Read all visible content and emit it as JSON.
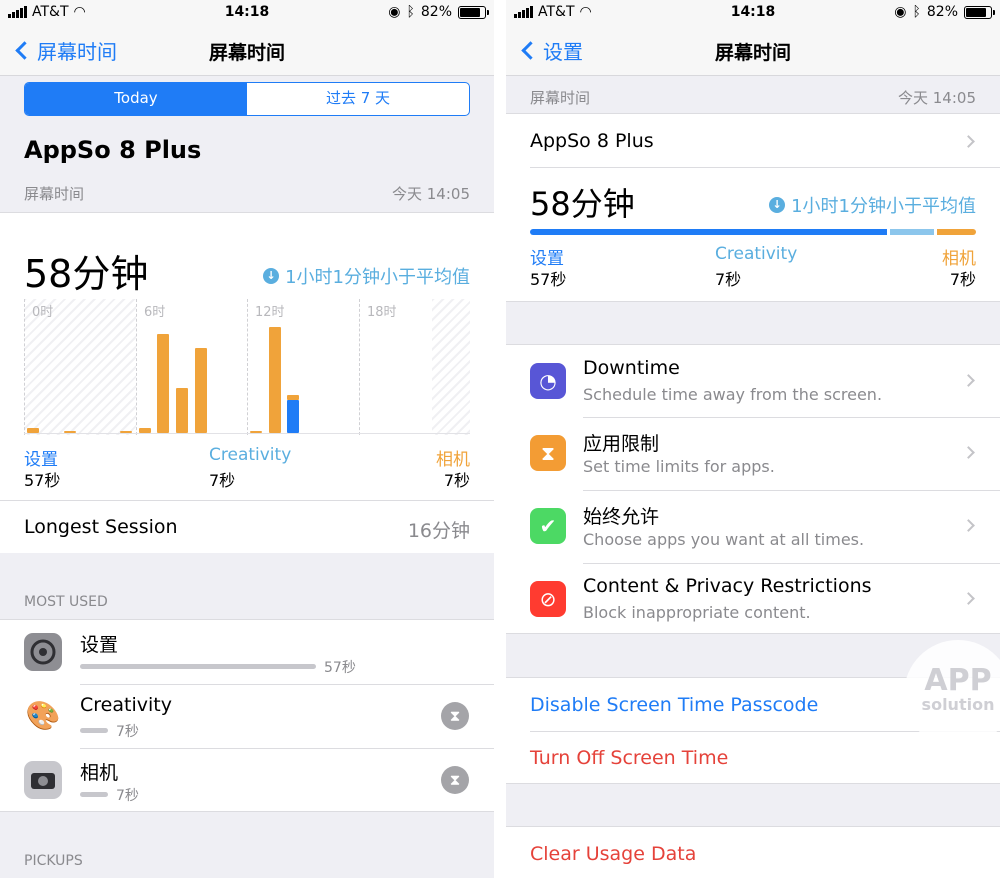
{
  "left": {
    "status": {
      "carrier": "AT&T",
      "time": "14:18",
      "battery": "82%"
    },
    "nav": {
      "back": "屏幕时间",
      "title": "屏幕时间"
    },
    "segment": {
      "today": "Today",
      "week": "过去 7 天"
    },
    "device": "AppSo 8 Plus",
    "section_label": "屏幕时间",
    "timestamp": "今天 14:05",
    "total": "58分钟",
    "avg_note": "1小时1分钟小于平均值",
    "categories": [
      {
        "name": "设置",
        "time": "57秒",
        "color": "#1f7cf6"
      },
      {
        "name": "Creativity",
        "time": "7秒",
        "color": "#5aaedf"
      },
      {
        "name": "相机",
        "time": "7秒",
        "color": "#f0a33a"
      }
    ],
    "longest_label": "Longest Session",
    "longest_value": "16分钟",
    "most_used_header": "MOST USED",
    "apps": [
      {
        "name": "设置",
        "time": "57秒",
        "icon": "settings-gear-icon"
      },
      {
        "name": "Creativity",
        "time": "7秒",
        "icon": "palette-icon"
      },
      {
        "name": "相机",
        "time": "7秒",
        "icon": "camera-icon"
      }
    ],
    "pickups_header": "PICKUPS"
  },
  "right": {
    "status": {
      "carrier": "AT&T",
      "time": "14:18",
      "battery": "82%"
    },
    "nav": {
      "back": "设置",
      "title": "屏幕时间"
    },
    "section_label": "屏幕时间",
    "timestamp": "今天 14:05",
    "device": "AppSo 8 Plus",
    "total": "58分钟",
    "avg_note": "1小时1分钟小于平均值",
    "categories": [
      {
        "name": "设置",
        "time": "57秒"
      },
      {
        "name": "Creativity",
        "time": "7秒"
      },
      {
        "name": "相机",
        "time": "7秒"
      }
    ],
    "menu": [
      {
        "title": "Downtime",
        "subtitle": "Schedule time away from the screen.",
        "icon": "downtime-moon-icon",
        "color": "#5856d6"
      },
      {
        "title": "应用限制",
        "subtitle": "Set time limits for apps.",
        "icon": "hourglass-icon",
        "color": "#f39c34"
      },
      {
        "title": "始终允许",
        "subtitle": "Choose apps you want at all times.",
        "icon": "checkmark-badge-icon",
        "color": "#4cd964"
      },
      {
        "title": "Content & Privacy Restrictions",
        "subtitle": "Block inappropriate content.",
        "icon": "no-entry-icon",
        "color": "#ff3b30"
      }
    ],
    "passcode_action": "Disable Screen Time Passcode",
    "turn_off": "Turn Off Screen Time",
    "clear": "Clear Usage Data",
    "watermark_top": "APP",
    "watermark_bottom": "solution"
  },
  "chart_data": {
    "type": "bar",
    "x_tick_labels": [
      "0时",
      "6时",
      "12时",
      "18时"
    ],
    "bars": [
      {
        "hour": 0,
        "orange": 2,
        "blue": 0
      },
      {
        "hour": 2,
        "orange": 1,
        "blue": 0
      },
      {
        "hour": 5,
        "orange": 1,
        "blue": 0
      },
      {
        "hour": 6,
        "orange": 2,
        "blue": 0
      },
      {
        "hour": 7,
        "orange": 42,
        "blue": 0
      },
      {
        "hour": 8,
        "orange": 19,
        "blue": 0
      },
      {
        "hour": 9,
        "orange": 36,
        "blue": 0
      },
      {
        "hour": 12,
        "orange": 1,
        "blue": 0
      },
      {
        "hour": 13,
        "orange": 45,
        "blue": 0
      },
      {
        "hour": 14,
        "orange": 2,
        "blue": 14
      }
    ],
    "y_max": 50,
    "grid": true
  }
}
